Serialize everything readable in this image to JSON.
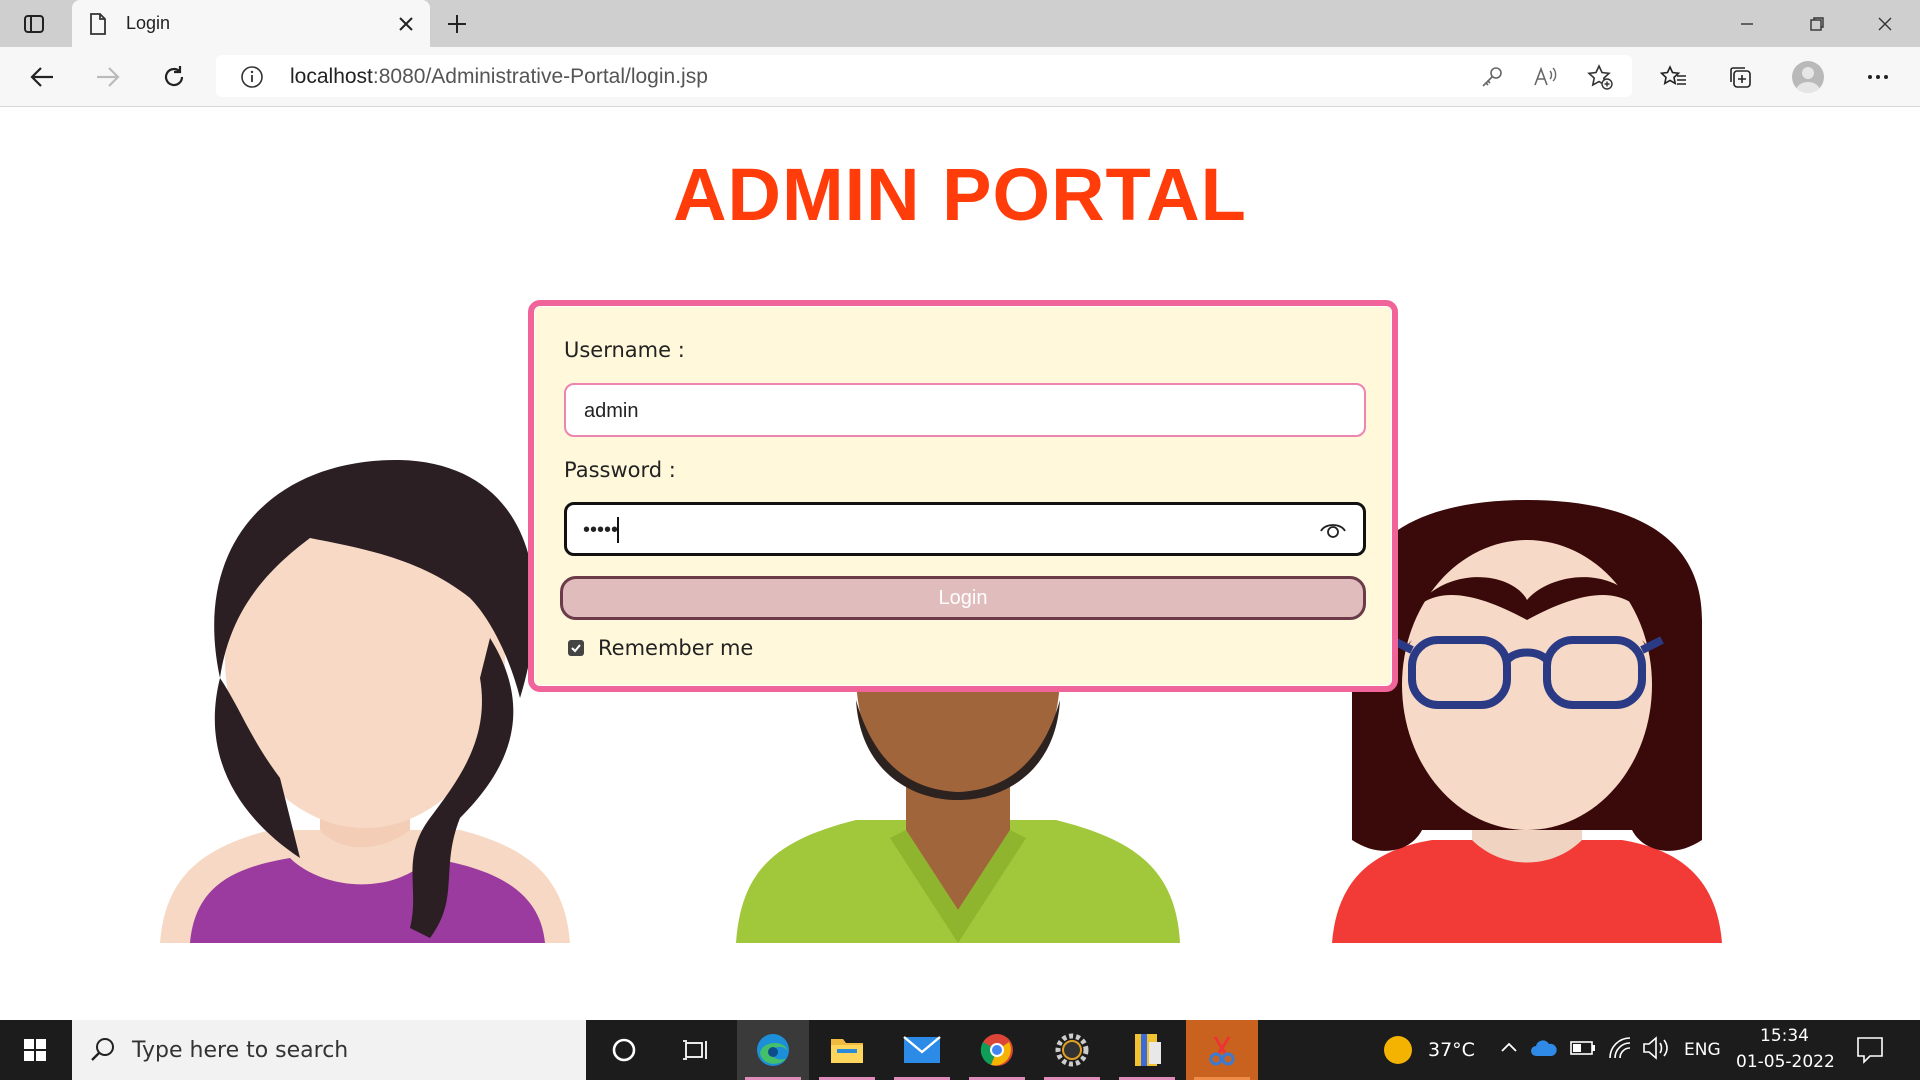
{
  "browser": {
    "tab_title": "Login",
    "url_host": "localhost",
    "url_path": ":8080/Administrative-Portal/login.jsp",
    "icons": [
      "tab-actions-icon",
      "page-icon",
      "close-icon",
      "plus-icon",
      "minimize-icon",
      "restore-icon",
      "close-window-icon",
      "back-icon",
      "forward-icon",
      "refresh-icon",
      "info-icon",
      "key-icon",
      "read-aloud-icon",
      "add-favorite-icon",
      "favorites-icon",
      "collections-icon",
      "profile-icon",
      "more-icon"
    ]
  },
  "page": {
    "title": "ADMIN PORTAL",
    "accent_color": "#ff3c0a",
    "box_border_color": "#f0649a",
    "box_bg": "#fff8db"
  },
  "form": {
    "username_label": "Username :",
    "username_value": "admin",
    "password_label": "Password :",
    "password_value": "•••••",
    "login_label": "Login",
    "remember_label": "Remember me",
    "remember_checked": true
  },
  "taskbar": {
    "search_placeholder": "Type here to search",
    "temperature": "37°C",
    "language": "ENG",
    "time": "15:34",
    "date": "01-05-2022",
    "apps": [
      "cortana",
      "task-view",
      "edge",
      "file-explorer",
      "mail",
      "chrome",
      "settings-app",
      "archive-app",
      "snipping-tool"
    ]
  }
}
